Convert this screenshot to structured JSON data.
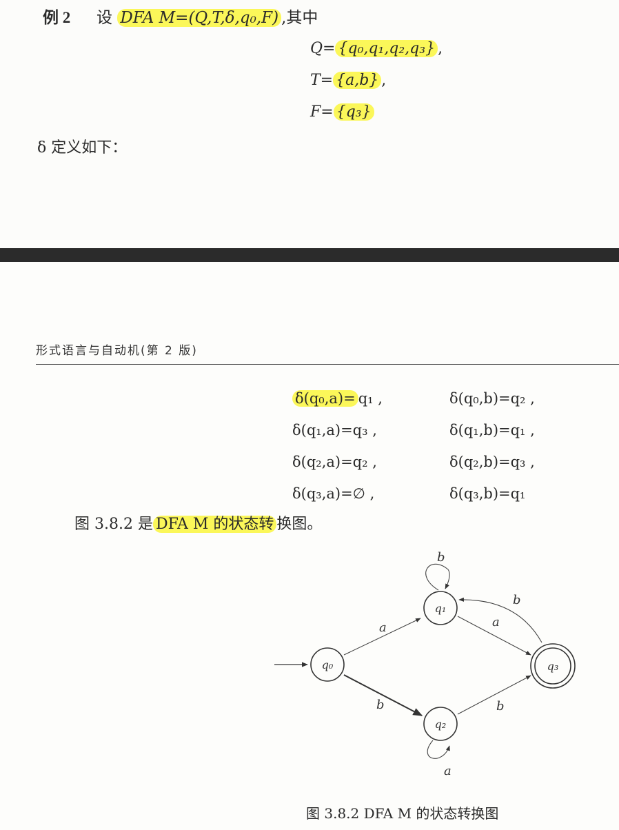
{
  "example": {
    "label": "例 2",
    "intro_prefix": "设",
    "intro_highlight": "DFA M=(Q,T,δ,q₀,F)",
    "intro_suffix": ",其中",
    "Q_lhs": "Q=",
    "Q_set": "{q₀,q₁,q₂,q₃}",
    "Q_end": ",",
    "T_lhs": "T=",
    "T_set": "{a,b}",
    "T_end": ",",
    "F_lhs": "F=",
    "F_set": "{q₃}",
    "delta_intro": "δ 定义如下："
  },
  "running_header": "形式语言与自动机(第 2 版)",
  "transitions": [
    {
      "left_hl": "δ(q₀,a)=",
      "left_rest": "q₁ ,",
      "right": "δ(q₀,b)=q₂ ,"
    },
    {
      "left_hl": "",
      "left_rest": "δ(q₁,a)=q₃ ,",
      "right": "δ(q₁,b)=q₁ ,"
    },
    {
      "left_hl": "",
      "left_rest": "δ(q₂,a)=q₂ ,",
      "right": "δ(q₂,b)=q₃ ,"
    },
    {
      "left_hl": "",
      "left_rest": "δ(q₃,a)=∅ ,",
      "right": "δ(q₃,b)=q₁"
    }
  ],
  "figure_ref": {
    "prefix": "图 3.8.2 是",
    "highlight": "DFA M 的状态转",
    "suffix": "换图。"
  },
  "diagram": {
    "states": [
      {
        "id": "q0",
        "label": "q₀",
        "accepting": false
      },
      {
        "id": "q1",
        "label": "q₁",
        "accepting": false
      },
      {
        "id": "q2",
        "label": "q₂",
        "accepting": false
      },
      {
        "id": "q3",
        "label": "q₃",
        "accepting": true
      }
    ],
    "edge_labels": {
      "q0_q1": "a",
      "q0_q2": "b",
      "q1_q3": "a",
      "q2_q3": "b",
      "q3_q1": "b",
      "q1_loop": "b",
      "q2_loop": "a"
    }
  },
  "caption": "图 3.8.2   DFA M 的状态转换图",
  "colors": {
    "highlight": "#faf63c",
    "band": "#2b2b2b"
  }
}
